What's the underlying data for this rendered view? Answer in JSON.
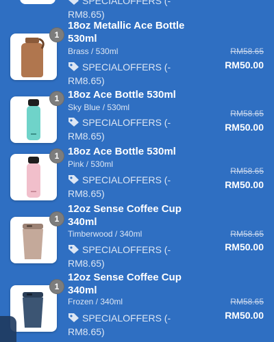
{
  "top_partial": {
    "discount_line1": "SPECIALOFFERS (-",
    "discount_line2": "RM8.65)"
  },
  "items": [
    {
      "qty": "1",
      "name": "18oz Metallic Ace Bottle 530ml",
      "variant": "Brass / 530ml",
      "discount_line1": "SPECIALOFFERS (-",
      "discount_line2": "RM8.65)",
      "old_price": "RM58.65",
      "new_price": "RM50.00",
      "image_color": "#b0764e"
    },
    {
      "qty": "1",
      "name": "18oz Ace Bottle 530ml",
      "variant": "Sky Blue / 530ml",
      "discount_line1": "SPECIALOFFERS (-",
      "discount_line2": "RM8.65)",
      "old_price": "RM58.65",
      "new_price": "RM50.00",
      "image_color": "#6fd3c9"
    },
    {
      "qty": "1",
      "name": "18oz Ace Bottle 530ml",
      "variant": "Pink / 530ml",
      "discount_line1": "SPECIALOFFERS (-",
      "discount_line2": "RM8.65)",
      "old_price": "RM58.65",
      "new_price": "RM50.00",
      "image_color": "#f1bfcb"
    },
    {
      "qty": "1",
      "name": "12oz Sense Coffee Cup 340ml",
      "variant": "Timberwood / 340ml",
      "discount_line1": "SPECIALOFFERS (-",
      "discount_line2": "RM8.65)",
      "old_price": "RM58.65",
      "new_price": "RM50.00",
      "image_color": "#c4a99a"
    },
    {
      "qty": "1",
      "name": "12oz Sense Coffee Cup 340ml",
      "variant": "Frozen / 340ml",
      "discount_line1": "SPECIALOFFERS (-",
      "discount_line2": "RM8.65)",
      "old_price": "RM58.65",
      "new_price": "RM50.00",
      "image_color": "#3c5573"
    }
  ]
}
